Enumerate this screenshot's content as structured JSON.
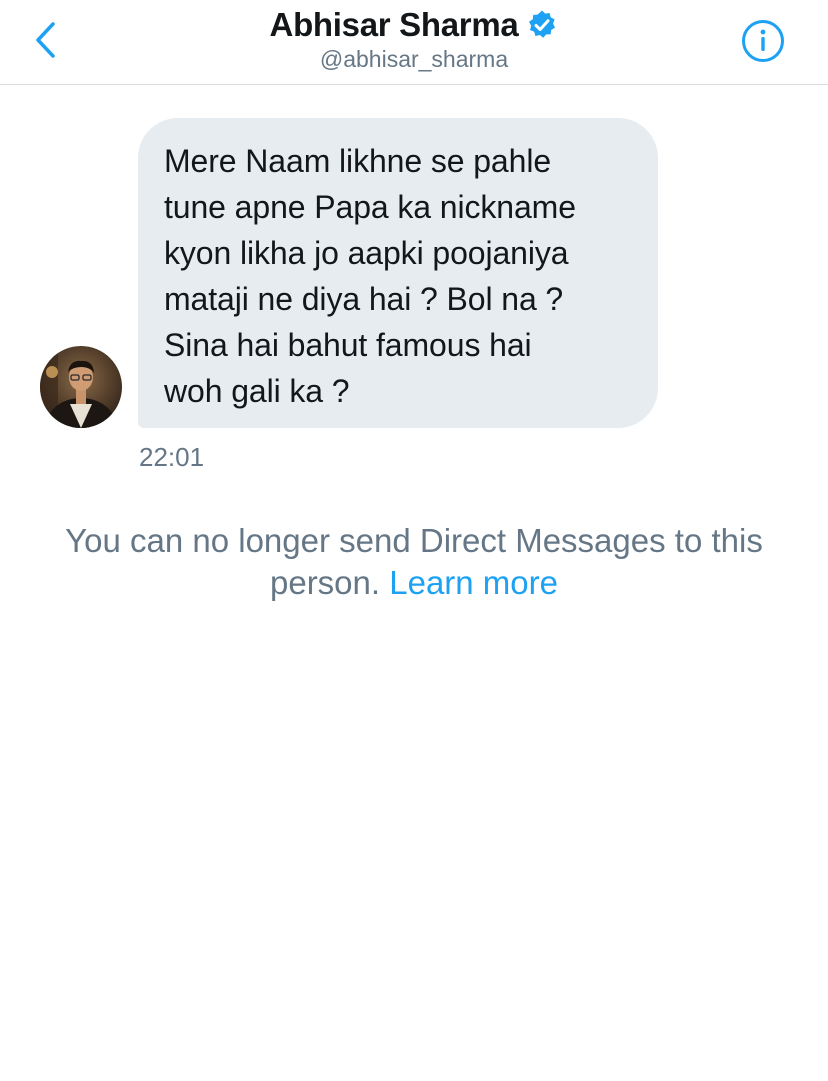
{
  "header": {
    "title": "Abhisar Sharma",
    "handle": "@abhisar_sharma",
    "back_icon": "chevron-left-icon",
    "verified_icon": "verified-badge-icon",
    "info_icon": "info-icon"
  },
  "conversation": {
    "messages": [
      {
        "text": "Mere Naam likhne se pahle\ntune apne Papa ka nickname\nkyon likha jo aapki poojaniya\nmataji ne diya hai ? Bol na ?\nSina hai bahut famous hai\nwoh gali ka ?",
        "time": "22:01"
      }
    ]
  },
  "notice": {
    "text": "You can no longer send Direct Messages to this person.",
    "link": "Learn more"
  },
  "colors": {
    "accent": "#1da1f2",
    "bubble": "#e6ecf0",
    "secondary_text": "#657786",
    "primary_text": "#14171a"
  }
}
